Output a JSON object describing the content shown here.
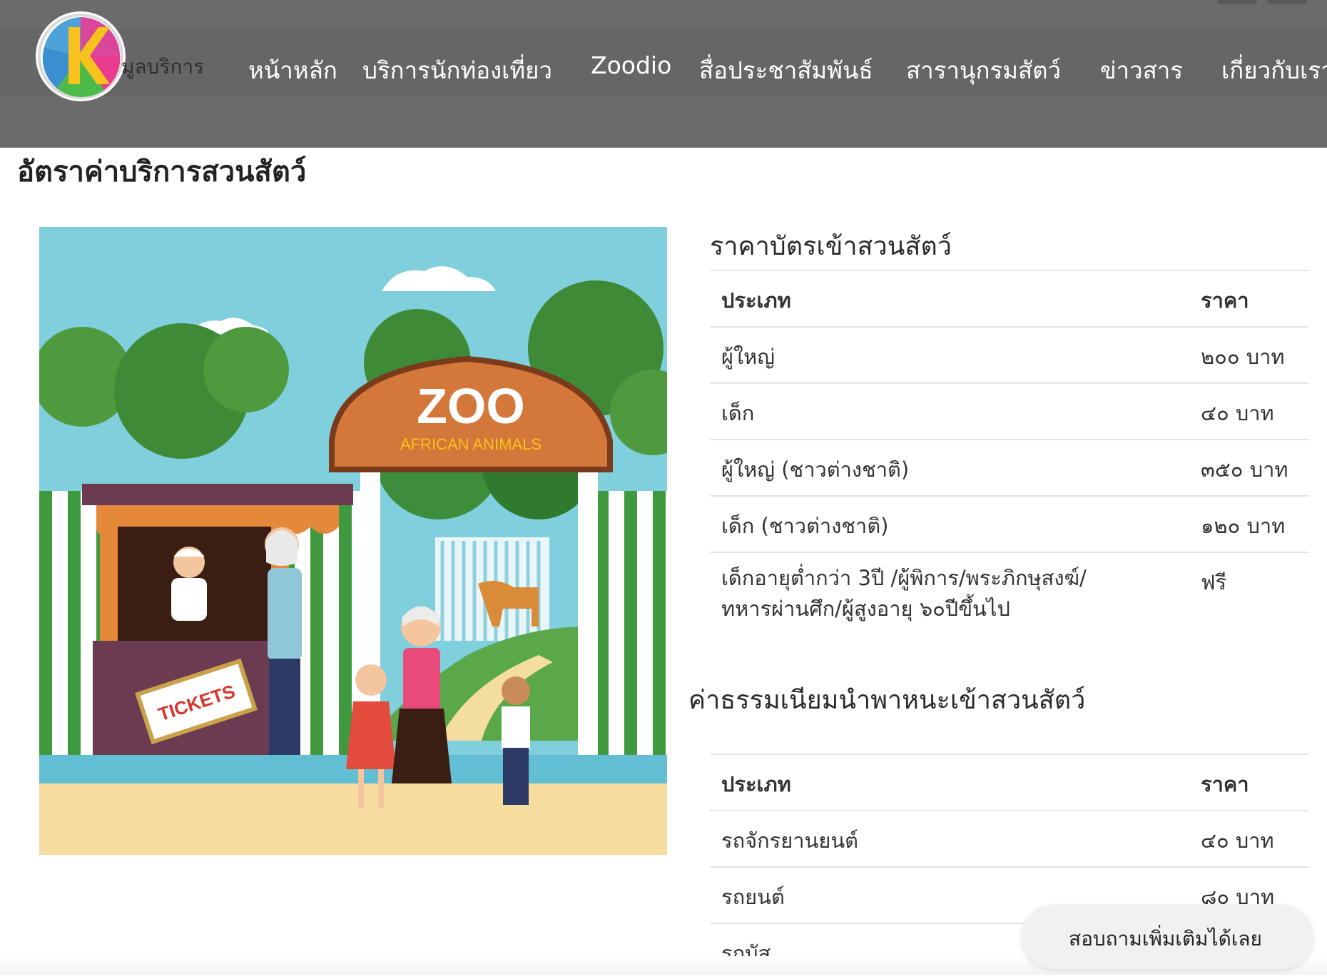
{
  "header": {
    "logo_text": "มูลบริการ",
    "nav": [
      {
        "label": "หน้าหลัก"
      },
      {
        "label": "บริการนักท่องเที่ยว"
      },
      {
        "label": "Zoodio"
      },
      {
        "label": "สื่อประชาสัมพันธ์"
      },
      {
        "label": "สารานุกรมสัตว์"
      },
      {
        "label": "ข่าวสาร"
      },
      {
        "label": "เกี่ยวกับเรา"
      }
    ]
  },
  "page": {
    "title": "อัตราค่าบริการสวนสัตว์"
  },
  "illustration": {
    "sign_title": "ZOO",
    "sign_subtitle": "AFRICAN ANIMALS",
    "tickets_label": "TICKETS"
  },
  "ticket_table": {
    "title": "ราคาบัตรเข้าสวนสัตว์",
    "header_type": "ประเภท",
    "header_price": "ราคา",
    "rows": [
      {
        "type": "ผู้ใหญ่",
        "price": "๒๐๐ บาท"
      },
      {
        "type": "เด็ก",
        "price": "๔๐ บาท"
      },
      {
        "type": "ผู้ใหญ่ (ชาวต่างชาติ)",
        "price": "๓๕๐ บาท"
      },
      {
        "type": "เด็ก (ชาวต่างชาติ)",
        "price": "๑๒๐ บาท"
      },
      {
        "type": "เด็กอายุต่ำกว่า 3ปี /ผู้พิการ/พระภิกษุสงฆ์/ทหารผ่านศึก/ผู้สูงอายุ ๖๐ปีขึ้นไป",
        "price": "ฟรี"
      }
    ]
  },
  "vehicle_table": {
    "title": "ค่าธรรมเนียมนำพาหนะเข้าสวนสัตว์",
    "header_type": "ประเภท",
    "header_price": "ราคา",
    "rows": [
      {
        "type": "รถจักรยานยนต์",
        "price": "๔๐ บาท"
      },
      {
        "type": "รถยนต์",
        "price": "๘๐ บาท"
      },
      {
        "type": "รถบัส",
        "price": ""
      }
    ]
  },
  "chat": {
    "label": "สอบถามเพิ่มเติมได้เลย"
  },
  "colors": {
    "header_bg": "#6b6b6b",
    "sky": "#7fcfdc",
    "sign": "#d4773a",
    "booth": "#6b3b52"
  }
}
